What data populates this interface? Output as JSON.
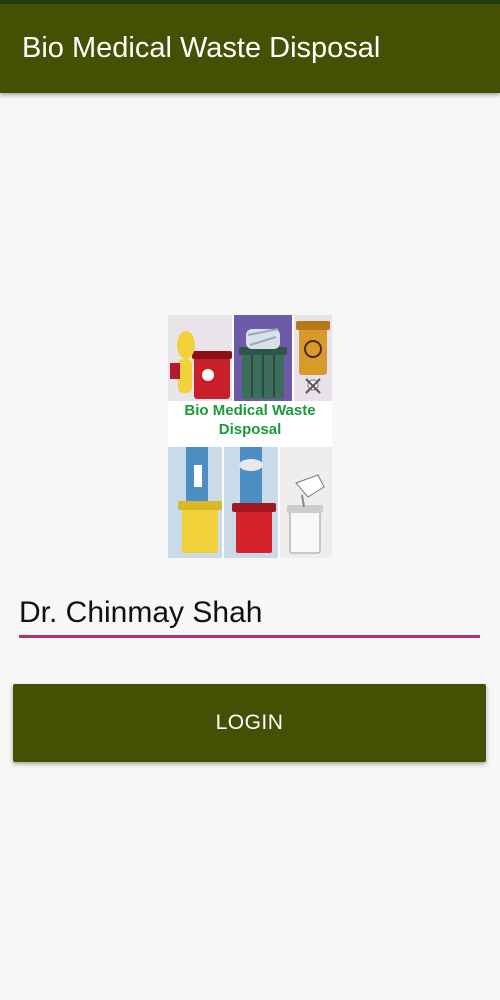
{
  "app": {
    "title": "Bio Medical Waste Disposal"
  },
  "logo": {
    "line1": "Bio Medical Waste",
    "line2": "Disposal"
  },
  "form": {
    "name_value": "Dr. Chinmay Shah",
    "login_label": "LOGIN"
  },
  "colors": {
    "appbar": "#445003",
    "status_bar": "#1f3d12",
    "input_underline": "#b0326b",
    "logo_text": "#1a9a3a",
    "background": "#f7f7f7"
  }
}
